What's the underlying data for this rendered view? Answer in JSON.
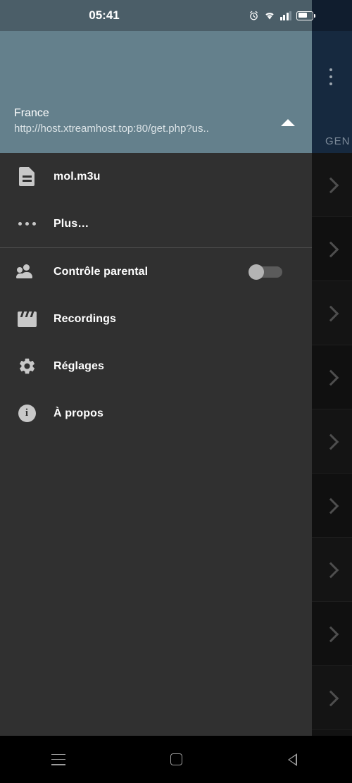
{
  "status_bar": {
    "time": "05:41",
    "icons": [
      "alarm-icon",
      "wifi-icon",
      "signal-bars-icon",
      "battery-icon"
    ]
  },
  "background_app": {
    "overflow_menu_icon": "kebab-menu-icon",
    "tab_label": "GEN",
    "row_chevron_icon": "chevron-right-icon",
    "row_count": 9,
    "appbar_color": "#16293f"
  },
  "drawer": {
    "header": {
      "account_name": "France",
      "account_url": "http://host.xtreamhost.top:80/get.php?us..",
      "expand_arrow_icon": "triangle-up-icon",
      "background_color": "#64808c"
    },
    "groups": [
      {
        "items": [
          {
            "label": "mol.m3u",
            "icon": "document-icon",
            "trailing": null
          },
          {
            "label": "Plus…",
            "icon": "more-horizontal-icon",
            "trailing": null
          }
        ]
      },
      {
        "items": [
          {
            "label": "Contrôle parental",
            "icon": "people-icon",
            "trailing": "toggle-switch",
            "toggle_state": "off"
          },
          {
            "label": "Recordings",
            "icon": "clapperboard-icon",
            "trailing": null
          },
          {
            "label": "Réglages",
            "icon": "gear-icon",
            "trailing": null
          },
          {
            "label": "À propos",
            "icon": "info-icon",
            "trailing": null
          }
        ]
      }
    ]
  },
  "nav_bar": {
    "buttons": [
      {
        "name": "recents-button",
        "icon": "hamburger-icon"
      },
      {
        "name": "home-button",
        "icon": "square-icon"
      },
      {
        "name": "back-button",
        "icon": "triangle-left-icon"
      }
    ]
  }
}
